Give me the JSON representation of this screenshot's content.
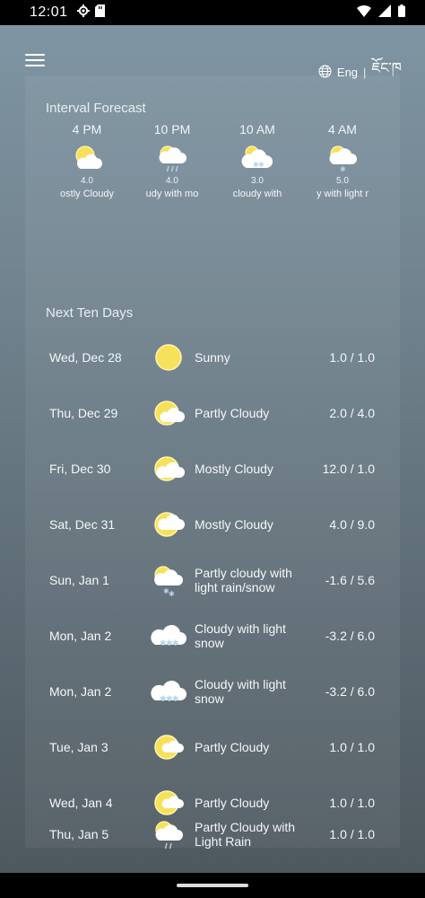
{
  "status_bar": {
    "time": "12:01",
    "icons_left": [
      "gear-icon",
      "sd-card-icon"
    ],
    "icons_right": [
      "wifi-icon",
      "signal-icon",
      "battery-icon"
    ]
  },
  "header": {
    "menu_icon": "hamburger-icon",
    "lang_icon": "globe-icon",
    "lang_label": "Eng",
    "separator": "|",
    "alt_lang_label": "ཇོང་ཁ"
  },
  "interval": {
    "title": "Interval Forecast",
    "items": [
      {
        "time": "4 PM",
        "value": "4.0",
        "desc": "ostly Cloudy",
        "icon": "partly-cloudy-icon"
      },
      {
        "time": "10 PM",
        "value": "4.0",
        "desc": "udy with mo",
        "icon": "cloudy-rain-icon"
      },
      {
        "time": "10 AM",
        "value": "3.0",
        "desc": "cloudy with",
        "icon": "cloudy-snow-icon"
      },
      {
        "time": "4 AM",
        "value": "5.0",
        "desc": "y with light r",
        "icon": "partly-cloudy-snow-icon"
      }
    ]
  },
  "ten_days": {
    "title": "Next Ten Days",
    "days": [
      {
        "date": "Wed, Dec 28",
        "condition": "Sunny",
        "temp": "1.0 / 1.0",
        "icon": "sun-icon"
      },
      {
        "date": "Thu, Dec 29",
        "condition": "Partly Cloudy",
        "temp": "2.0 / 4.0",
        "icon": "partly-cloudy-icon"
      },
      {
        "date": "Fri, Dec 30",
        "condition": "Mostly Cloudy",
        "temp": "12.0 / 1.0",
        "icon": "mostly-cloudy-icon"
      },
      {
        "date": "Sat, Dec 31",
        "condition": "Mostly Cloudy",
        "temp": "4.0 / 9.0",
        "icon": "mostly-cloudy-icon"
      },
      {
        "date": "Sun, Jan 1",
        "condition": "Partly cloudy with light rain/snow",
        "temp": "-1.6 / 5.6",
        "icon": "partly-cloudy-snow-icon"
      },
      {
        "date": "Mon, Jan 2",
        "condition": "Cloudy with light snow",
        "temp": "-3.2 / 6.0",
        "icon": "cloudy-snow-icon"
      },
      {
        "date": "Mon, Jan 2",
        "condition": "Cloudy with light snow",
        "temp": "-3.2 / 6.0",
        "icon": "cloudy-snow-icon"
      },
      {
        "date": "Tue, Jan 3",
        "condition": "Partly Cloudy",
        "temp": "1.0 / 1.0",
        "icon": "partly-cloudy-icon"
      },
      {
        "date": "Wed, Jan 4",
        "condition": "Partly Cloudy",
        "temp": "1.0 / 1.0",
        "icon": "partly-cloudy-icon"
      },
      {
        "date": "Thu, Jan 5",
        "condition": "Partly Cloudy with Light Rain",
        "temp": "1.0 / 1.0",
        "icon": "partly-cloudy-rain-icon"
      }
    ]
  },
  "colors": {
    "sun": "#f7e05a",
    "cloud": "#ffffff",
    "accent": "#b8d4ea"
  }
}
